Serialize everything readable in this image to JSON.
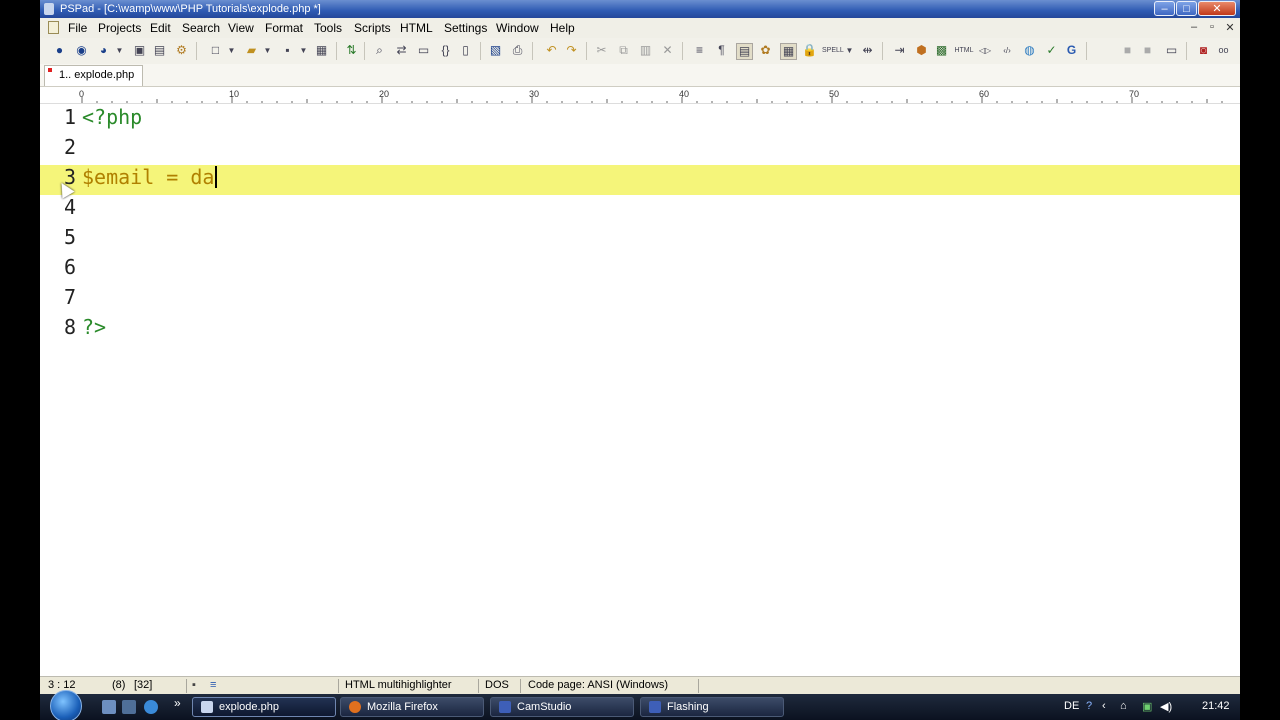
{
  "window": {
    "title": "PSPad - [C:\\wamp\\www\\PHP Tutorials\\explode.php *]",
    "controls": {
      "minimize": "–",
      "maximize": "□",
      "close": "✕"
    }
  },
  "menu": [
    "File",
    "Projects",
    "Edit",
    "Search",
    "View",
    "Format",
    "Tools",
    "Scripts",
    "HTML",
    "Settings",
    "Window",
    "Help"
  ],
  "mdi_controls": {
    "minimize": "–",
    "restore": "▫",
    "close": "✕"
  },
  "tab": {
    "label": "1.. explode.php"
  },
  "ruler": {
    "labels": [
      "0",
      "10",
      "20",
      "30",
      "40",
      "50",
      "60",
      "70"
    ]
  },
  "editor": {
    "lines": [
      {
        "num": "1",
        "text": "<?php"
      },
      {
        "num": "2",
        "text": ""
      },
      {
        "num": "3",
        "text": "$email = da"
      },
      {
        "num": "4",
        "text": ""
      },
      {
        "num": "5",
        "text": ""
      },
      {
        "num": "6",
        "text": ""
      },
      {
        "num": "7",
        "text": ""
      },
      {
        "num": "8",
        "text": "?>"
      }
    ]
  },
  "statusbar": {
    "position": "3 : 12",
    "chars": "(8)",
    "code": "[32]",
    "highlighter": "HTML multihighlighter",
    "lineend": "DOS",
    "codepage": "Code page: ANSI (Windows)"
  },
  "taskbar": {
    "tasks": [
      "explode.php",
      "Mozilla Firefox",
      "CamStudio",
      "Flashing"
    ],
    "overflow": "»",
    "lang": "DE",
    "clock": "21:42"
  },
  "colors": {
    "current_line": "#f5f57a",
    "keyword": "#2a8a2a",
    "variable": "#b08000",
    "titlebar": "#2f5bb3"
  }
}
